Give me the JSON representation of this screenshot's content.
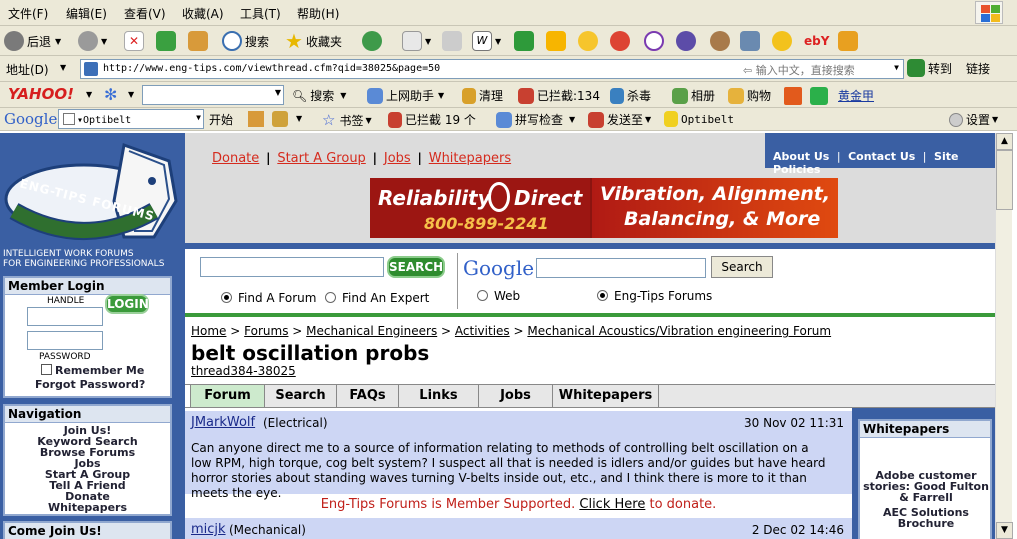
{
  "menubar": {
    "items": [
      "文件(F)",
      "编辑(E)",
      "查看(V)",
      "收藏(A)",
      "工具(T)",
      "帮助(H)"
    ]
  },
  "toolbar": {
    "back": "后退",
    "search": "搜索",
    "favorites": "收藏夹"
  },
  "addressbar": {
    "label": "地址(D)",
    "url": "http://www.eng-tips.com/viewthread.cfm?qid=38025&page=50",
    "hint": "输入中文，直接搜索",
    "go": "转到",
    "links": "链接"
  },
  "yahoobar": {
    "logo": "YAHOO!",
    "search": "搜索",
    "assistant": "上网助手",
    "clean": "清理",
    "blocked": "已拦截:134",
    "antivirus": "杀毒",
    "album": "相册",
    "shopping": "购物",
    "mail": "黄金甲"
  },
  "googlebar": {
    "logo": "Google",
    "query": "Optibelt",
    "start": "开始",
    "bookmarks": "书签",
    "blocked": "已拦截 19 个",
    "spellcheck": "拼写检查",
    "sendto": "发送至",
    "highlight": "Optibelt",
    "settings": "设置"
  },
  "site": {
    "logo_text": "ENG-TIPS FORUMS",
    "tagline_1": "INTELLIGENT WORK FORUMS",
    "tagline_2": "FOR ENGINEERING PROFESSIONALS",
    "top_links": [
      "Donate",
      "Start A Group",
      "Jobs",
      "Whitepapers"
    ],
    "right_links": [
      "About Us",
      "Contact Us",
      "Site Policies"
    ],
    "banner_brand": "Reliability",
    "banner_brand2": "Direct",
    "banner_phone": "800-899-2241",
    "banner_tag1": "Vibration, Alignment,",
    "banner_tag2": "Balancing, & More"
  },
  "search": {
    "button": "SEARCH",
    "opt_forum": "Find A Forum",
    "opt_expert": "Find An Expert",
    "google_logo": "Google",
    "google_button": "Search",
    "opt_web": "Web",
    "opt_site": "Eng-Tips Forums"
  },
  "login": {
    "header": "Member Login",
    "handle": "HANDLE",
    "password": "PASSWORD",
    "button": "LOGIN",
    "remember": "Remember Me",
    "forgot": "Forgot Password?"
  },
  "navigation": {
    "header": "Navigation",
    "items": [
      "Join Us!",
      "Keyword Search",
      "Browse Forums",
      "Jobs",
      "Start A Group",
      "Tell A Friend",
      "Donate",
      "Whitepapers"
    ]
  },
  "comejoin": {
    "header": "Come Join Us!"
  },
  "breadcrumb": {
    "items": [
      "Home",
      "Forums",
      "Mechanical Engineers",
      "Activities",
      "Mechanical Acoustics/Vibration engineering Forum"
    ],
    "sep": ">"
  },
  "thread": {
    "title": "belt oscillation probs",
    "id": "thread384-38025"
  },
  "tabs": [
    "Forum",
    "Search",
    "FAQs",
    "Links",
    "Jobs",
    "Whitepapers"
  ],
  "posts": [
    {
      "author": "JMarkWolf",
      "role": "(Electrical)",
      "date": "30 Nov 02 11:31",
      "body": "Can anyone direct me to a source of information relating to methods of controlling belt oscillation on a low RPM, high torque, cog belt system? I suspect all that is needed is idlers and/or guides but have heard horror stories about standing waves turning V-belts inside out, etc., and I think there is more to it than meets the eye."
    },
    {
      "author": "micjk",
      "role": "(Mechanical)",
      "date": "2 Dec 02 14:46"
    }
  ],
  "donate_notice": {
    "text": "Eng-Tips Forums is Member Supported.",
    "link": "Click Here",
    "tail": "to donate."
  },
  "whitepapers": {
    "header": "Whitepapers",
    "items": [
      "Adobe customer stories: Good Fulton & Farrell",
      "AEC Solutions Brochure"
    ]
  }
}
